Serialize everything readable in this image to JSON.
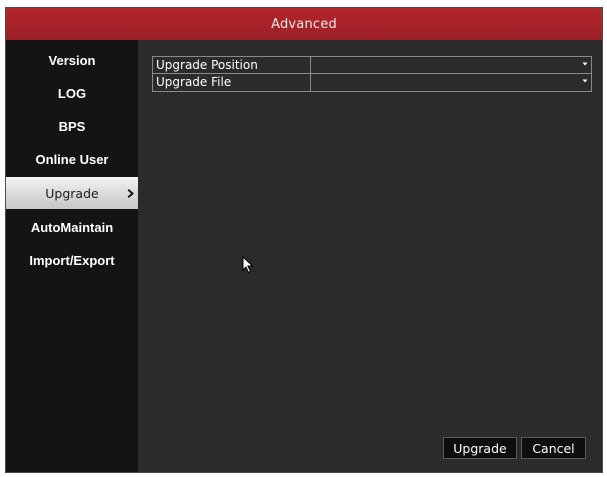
{
  "window": {
    "title": "Advanced"
  },
  "sidebar": {
    "items": [
      {
        "label": "Version",
        "active": false
      },
      {
        "label": "LOG",
        "active": false
      },
      {
        "label": "BPS",
        "active": false
      },
      {
        "label": "Online User",
        "active": false
      },
      {
        "label": "Upgrade",
        "active": true
      },
      {
        "label": "AutoMaintain",
        "active": false
      },
      {
        "label": "Import/Export",
        "active": false
      }
    ],
    "active_indicator_icon": "chevron-right-icon"
  },
  "upgrade_settings": {
    "rows": [
      {
        "label": "Upgrade Position",
        "value": ""
      },
      {
        "label": "Upgrade File",
        "value": ""
      }
    ],
    "dropdown_icon": "dropdown-arrow-icon"
  },
  "footer": {
    "upgrade_label": "Upgrade",
    "cancel_label": "Cancel"
  },
  "colors": {
    "title_bar": "#a8232a",
    "sidebar_bg": "#141414",
    "content_bg": "#2b2b2b",
    "active_item_bg": "#e0e0e0"
  }
}
